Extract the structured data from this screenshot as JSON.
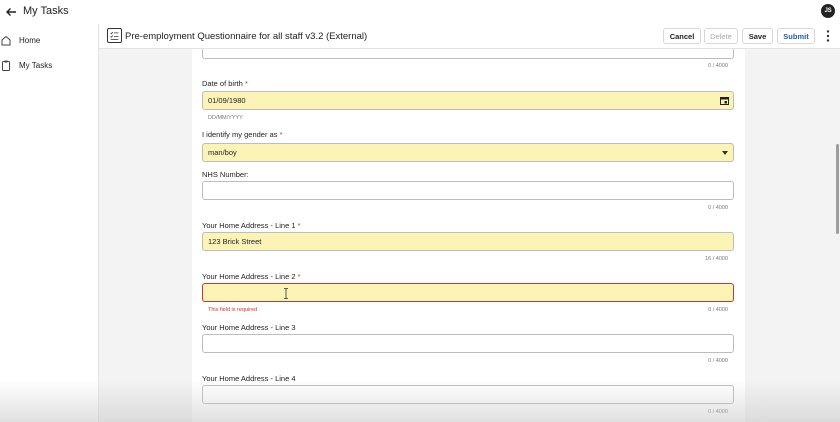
{
  "app": {
    "title": "My Tasks",
    "user_initials": "JS"
  },
  "sidebar": {
    "items": [
      {
        "label": "Home",
        "icon": "home-icon"
      },
      {
        "label": "My Tasks",
        "icon": "clipboard-icon"
      }
    ]
  },
  "header": {
    "form_title": "Pre-employment Questionnaire for all staff v3.2 (External)",
    "cancel_label": "Cancel",
    "delete_label": "Delete",
    "save_label": "Save",
    "submit_label": "Submit"
  },
  "form": {
    "top_counter": "0 / 4000",
    "dob": {
      "label": "Date of birth",
      "required": "*",
      "value": "01/09/1980",
      "hint": "DD/MM/YYYY"
    },
    "gender": {
      "label": "I identify my gender as",
      "required": "*",
      "value": "man/boy"
    },
    "nhs": {
      "label": "NHS Number:",
      "value": "",
      "counter": "0 / 4000"
    },
    "address1": {
      "label": "Your Home Address - Line 1",
      "required": "*",
      "value": "123 Brick Street",
      "counter": "16 / 4000"
    },
    "address2": {
      "label": "Your Home Address - Line 2",
      "required": "*",
      "value": "",
      "error": "This field is required",
      "counter": "0 / 4000"
    },
    "address3": {
      "label": "Your Home Address - Line 3",
      "value": "",
      "counter": "0 / 4000"
    },
    "address4": {
      "label": "Your Home Address - Line 4",
      "value": "",
      "counter": "0 / 4000"
    }
  },
  "colors": {
    "accent": "#2a5aa8",
    "filled_bg": "#fcf3b7",
    "error": "#d0342c"
  }
}
